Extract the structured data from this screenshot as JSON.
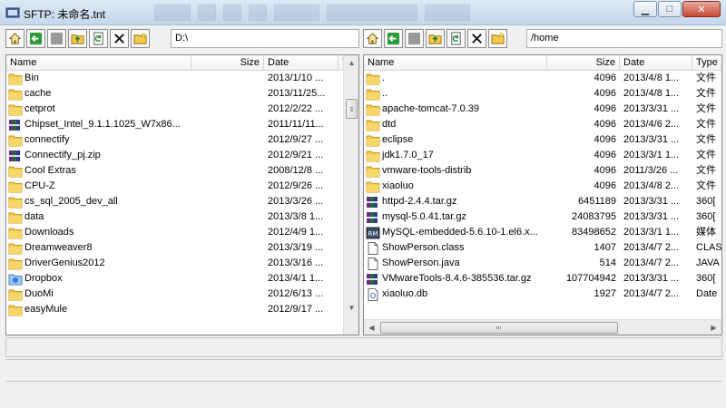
{
  "window": {
    "title": "SFTP: 未命名.tnt",
    "minimize": "▁",
    "maximize": "□",
    "close": "✕"
  },
  "icons": {
    "home": "home-icon",
    "back": "back-arrow-icon",
    "stop": "stop-icon",
    "upload": "folder-up-icon",
    "refresh": "refresh-icon",
    "delete": "delete-icon",
    "new_folder": "new-folder-icon"
  },
  "left": {
    "path": "D:\\",
    "columns": [
      "Name",
      "Size",
      "Date",
      "T"
    ],
    "rows": [
      {
        "name": "Bin",
        "icon": "folder",
        "size": "",
        "date": "2013/1/10 ...",
        "type": "",
        "alt": ""
      },
      {
        "name": "cache",
        "icon": "folder",
        "size": "",
        "date": "2013/11/25...",
        "type": "",
        "alt": ""
      },
      {
        "name": "cetprot",
        "icon": "folder",
        "size": "",
        "date": "2012/2/22 ...",
        "type": "",
        "alt": ""
      },
      {
        "name": "Chipset_Intel_9.1.1.1025_W7x86...",
        "icon": "archive",
        "size": "",
        "date": "2011/11/11...",
        "type": "",
        "alt": ""
      },
      {
        "name": "connectify",
        "icon": "folder",
        "size": "",
        "date": "2012/9/27 ...",
        "type": "",
        "alt": ""
      },
      {
        "name": "Connectify_pj.zip",
        "icon": "archive",
        "size": "",
        "date": "2012/9/21 ...",
        "type": "",
        "alt": ""
      },
      {
        "name": "Cool Extras",
        "icon": "folder",
        "size": "",
        "date": "2008/12/8 ...",
        "type": "",
        "alt": ""
      },
      {
        "name": "CPU-Z",
        "icon": "folder",
        "size": "",
        "date": "2012/9/26 ...",
        "type": "",
        "alt": ""
      },
      {
        "name": "cs_sql_2005_dev_all",
        "icon": "folder",
        "size": "",
        "date": "2013/3/26 ...",
        "type": "",
        "alt": ""
      },
      {
        "name": "data",
        "icon": "folder",
        "size": "",
        "date": "2013/3/8 1...",
        "type": "",
        "alt": ""
      },
      {
        "name": "Downloads",
        "icon": "folder",
        "size": "",
        "date": "2012/4/9 1...",
        "type": "",
        "alt": ""
      },
      {
        "name": "Dreamweaver8",
        "icon": "folder",
        "size": "",
        "date": "2013/3/19 ...",
        "type": "",
        "alt": ""
      },
      {
        "name": "DriverGenius2012",
        "icon": "folder",
        "size": "",
        "date": "2013/3/16 ...",
        "type": "",
        "alt": ""
      },
      {
        "name": "Dropbox",
        "icon": "dropbox",
        "size": "",
        "date": "2013/4/1 1...",
        "type": "",
        "alt": ""
      },
      {
        "name": "DuoMi",
        "icon": "folder",
        "size": "",
        "date": "2012/6/13 ...",
        "type": "",
        "alt": ""
      },
      {
        "name": "easyMule",
        "icon": "folder",
        "size": "",
        "date": "2012/9/17 ...",
        "type": "",
        "alt": ""
      }
    ]
  },
  "right": {
    "path": "/home",
    "columns": [
      "Name",
      "Size",
      "Date",
      "Type"
    ],
    "rows": [
      {
        "name": ".",
        "icon": "folder",
        "size": "4096",
        "date": "2013/4/8 1...",
        "type": "文件",
        "alt": ""
      },
      {
        "name": "..",
        "icon": "folder",
        "size": "4096",
        "date": "2013/4/8 1...",
        "type": "文件",
        "alt": ""
      },
      {
        "name": "apache-tomcat-7.0.39",
        "icon": "folder",
        "size": "4096",
        "date": "2013/3/31 ...",
        "type": "文件",
        "alt": ""
      },
      {
        "name": "dtd",
        "icon": "folder",
        "size": "4096",
        "date": "2013/4/6 2...",
        "type": "文件",
        "alt": ""
      },
      {
        "name": "eclipse",
        "icon": "folder",
        "size": "4096",
        "date": "2013/3/31 ...",
        "type": "文件",
        "alt": ""
      },
      {
        "name": "jdk1.7.0_17",
        "icon": "folder",
        "size": "4096",
        "date": "2013/3/1 1...",
        "type": "文件",
        "alt": ""
      },
      {
        "name": "vmware-tools-distrib",
        "icon": "folder",
        "size": "4096",
        "date": "2011/3/26 ...",
        "type": "文件",
        "alt": ""
      },
      {
        "name": "xiaoluo",
        "icon": "folder",
        "size": "4096",
        "date": "2013/4/8 2...",
        "type": "文件",
        "alt": ""
      },
      {
        "name": "httpd-2.4.4.tar.gz",
        "icon": "archive",
        "size": "6451189",
        "date": "2013/3/31 ...",
        "type": "360[",
        "alt": ""
      },
      {
        "name": "mysql-5.0.41.tar.gz",
        "icon": "archive",
        "size": "24083795",
        "date": "2013/3/31 ...",
        "type": "360[",
        "alt": ""
      },
      {
        "name": "MySQL-embedded-5.6.10-1.el6.x...",
        "icon": "rpm",
        "size": "83498652",
        "date": "2013/3/1 1...",
        "type": "媒体",
        "alt": "RM"
      },
      {
        "name": "ShowPerson.class",
        "icon": "file",
        "size": "1407",
        "date": "2013/4/7 2...",
        "type": "CLAS",
        "alt": ""
      },
      {
        "name": "ShowPerson.java",
        "icon": "file",
        "size": "514",
        "date": "2013/4/7 2...",
        "type": "JAVA",
        "alt": ""
      },
      {
        "name": "VMwareTools-8.4.6-385536.tar.gz",
        "icon": "archive",
        "size": "107704942",
        "date": "2013/3/31 ...",
        "type": "360[",
        "alt": ""
      },
      {
        "name": "xiaoluo.db",
        "icon": "db",
        "size": "1927",
        "date": "2013/4/7 2...",
        "type": "Date",
        "alt": ""
      }
    ]
  },
  "colors": {
    "folder": "#f2c94c",
    "folder_dark": "#d9a520",
    "title_gradient_top": "#dde9f5",
    "close_red": "#c74a36"
  }
}
